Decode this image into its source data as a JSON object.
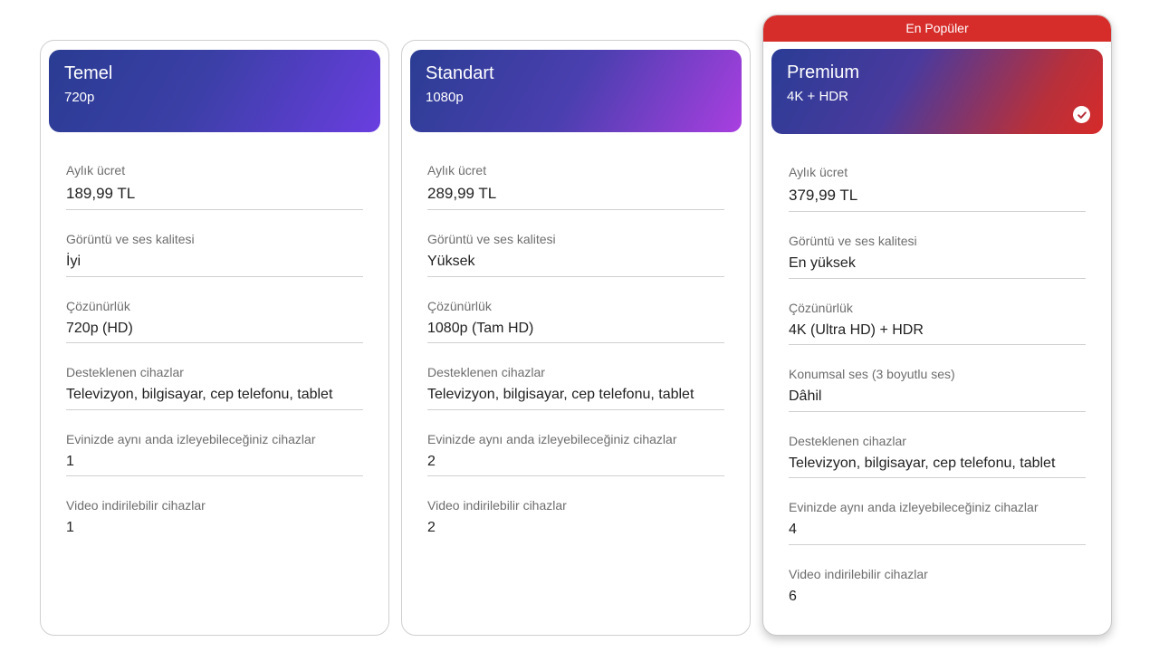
{
  "popular_badge": "En Popüler",
  "plans": [
    {
      "name": "Temel",
      "subtitle": "720p",
      "features": [
        {
          "label": "Aylık ücret",
          "value": "189,99 TL"
        },
        {
          "label": "Görüntü ve ses kalitesi",
          "value": "İyi"
        },
        {
          "label": "Çözünürlük",
          "value": "720p (HD)"
        },
        {
          "label": "Desteklenen cihazlar",
          "value": "Televizyon, bilgisayar, cep telefonu, tablet"
        },
        {
          "label": "Evinizde aynı anda izleyebileceğiniz cihazlar",
          "value": "1"
        },
        {
          "label": "Video indirilebilir cihazlar",
          "value": "1"
        }
      ]
    },
    {
      "name": "Standart",
      "subtitle": "1080p",
      "features": [
        {
          "label": "Aylık ücret",
          "value": "289,99 TL"
        },
        {
          "label": "Görüntü ve ses kalitesi",
          "value": "Yüksek"
        },
        {
          "label": "Çözünürlük",
          "value": "1080p (Tam HD)"
        },
        {
          "label": "Desteklenen cihazlar",
          "value": "Televizyon, bilgisayar, cep telefonu, tablet"
        },
        {
          "label": "Evinizde aynı anda izleyebileceğiniz cihazlar",
          "value": "2"
        },
        {
          "label": "Video indirilebilir cihazlar",
          "value": "2"
        }
      ]
    },
    {
      "name": "Premium",
      "subtitle": "4K + HDR",
      "selected": true,
      "features": [
        {
          "label": "Aylık ücret",
          "value": "379,99 TL"
        },
        {
          "label": "Görüntü ve ses kalitesi",
          "value": "En yüksek"
        },
        {
          "label": "Çözünürlük",
          "value": "4K (Ultra HD) + HDR"
        },
        {
          "label": "Konumsal ses (3 boyutlu ses)",
          "value": "Dâhil"
        },
        {
          "label": "Desteklenen cihazlar",
          "value": "Televizyon, bilgisayar, cep telefonu, tablet"
        },
        {
          "label": "Evinizde aynı anda izleyebileceğiniz cihazlar",
          "value": "4"
        },
        {
          "label": "Video indirilebilir cihazlar",
          "value": "6"
        }
      ]
    }
  ],
  "colors": {
    "popular_red": "#d72d2a",
    "label_gray": "#6d6d6d"
  }
}
